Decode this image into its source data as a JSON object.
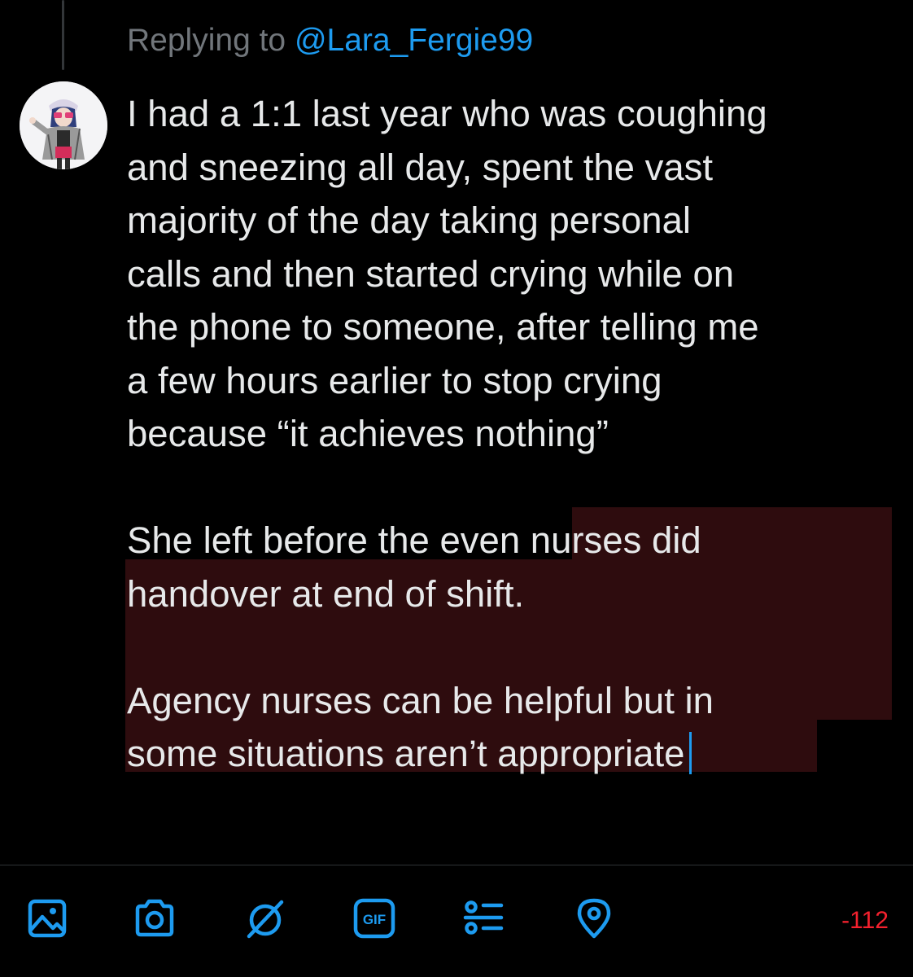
{
  "reply": {
    "prefix": "Replying to ",
    "handle": "@Lara_Fergie99"
  },
  "avatar": {
    "icon": "user-avatar-figurine"
  },
  "tweet_lines": [
    "I had a 1:1 last year who was coughing",
    "and sneezing all day, spent the vast",
    "majority of the day taking personal",
    "calls and then started crying while on",
    "the phone to someone, after telling me",
    "a few hours earlier to stop crying",
    "because “it achieves nothing”",
    "",
    "She left before the even nurses did",
    "handover at end of shift.",
    "",
    "Agency nurses can be helpful but in",
    "some situations aren’t appropriate"
  ],
  "toolbar": {
    "items": [
      {
        "name": "media-icon"
      },
      {
        "name": "camera-icon"
      },
      {
        "name": "alt-stroke-icon"
      },
      {
        "name": "gif-icon",
        "label": "GIF"
      },
      {
        "name": "poll-icon"
      },
      {
        "name": "location-icon"
      }
    ],
    "char_count": "-112"
  },
  "colors": {
    "background": "#000000",
    "text": "#e7e9ea",
    "muted": "#71767b",
    "accent": "#1d9bf0",
    "over_limit_highlight": "#2e0c0e",
    "over_limit_count": "#f4212e"
  }
}
